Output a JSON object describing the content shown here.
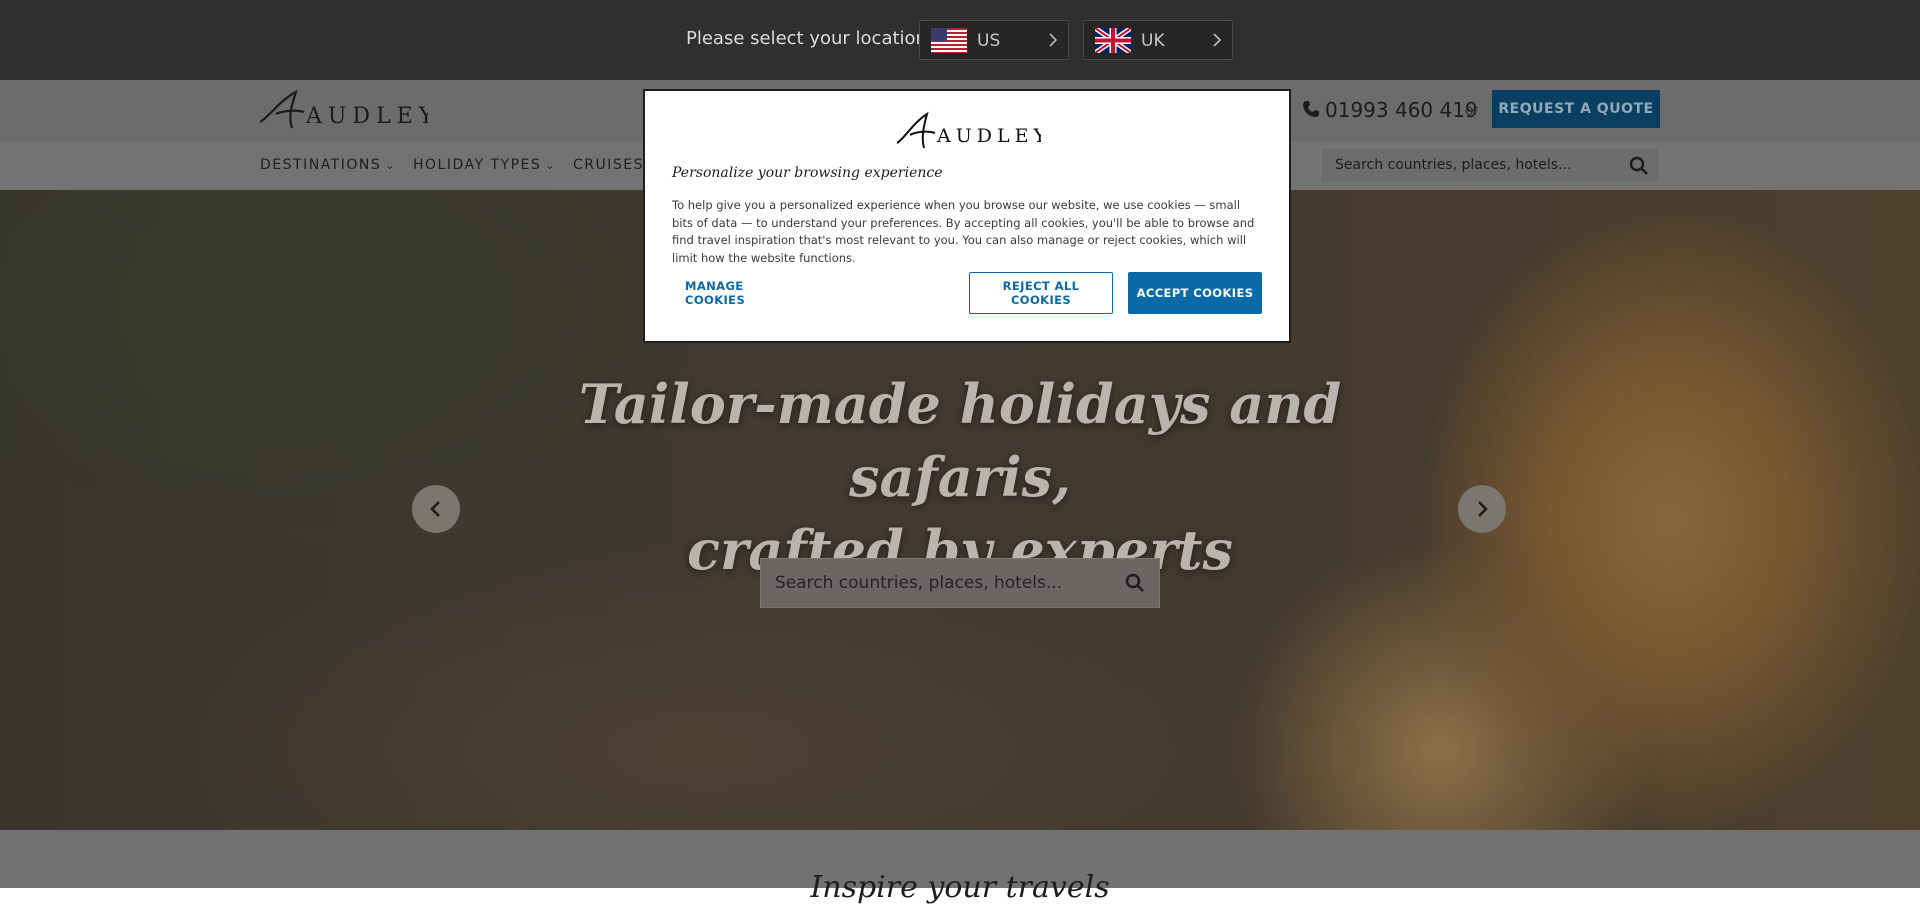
{
  "location_bar": {
    "prompt": "Please select your location:",
    "options": [
      {
        "code": "US",
        "flag": "us-flag-icon"
      },
      {
        "code": "UK",
        "flag": "uk-flag-icon"
      }
    ]
  },
  "header": {
    "logo": "AUDLEY",
    "phone": "01993 460 419",
    "or": "or",
    "quote_button": "REQUEST A QUOTE",
    "nav": [
      {
        "label": "DESTINATIONS",
        "dropdown": true
      },
      {
        "label": "HOLIDAY TYPES",
        "dropdown": true
      },
      {
        "label": "CRUISES",
        "dropdown": false
      }
    ],
    "search_placeholder": "Search countries, places, hotels..."
  },
  "hero": {
    "title_line1": "Tailor-made holidays and safaris,",
    "title_line2": "crafted by experts",
    "search_placeholder": "Search countries, places, hotels..."
  },
  "below": {
    "heading": "Inspire your travels"
  },
  "cookie_modal": {
    "logo": "AUDLEY",
    "title": "Personalize your browsing experience",
    "body": "To help give you a personalized experience when you browse our website, we use cookies — small bits of data — to understand your preferences. By accepting all cookies, you'll be able to browse and find travel inspiration that's most relevant to you. You can also manage or reject cookies, which will limit how the website functions.",
    "manage": "MANAGE COOKIES",
    "reject": "REJECT ALL COOKIES",
    "accept": "ACCEPT COOKIES"
  },
  "colors": {
    "accent_blue": "#0a6aa8",
    "quote_blue_dimmed": "#0a3f62",
    "top_bar": "#2f2f2f"
  }
}
